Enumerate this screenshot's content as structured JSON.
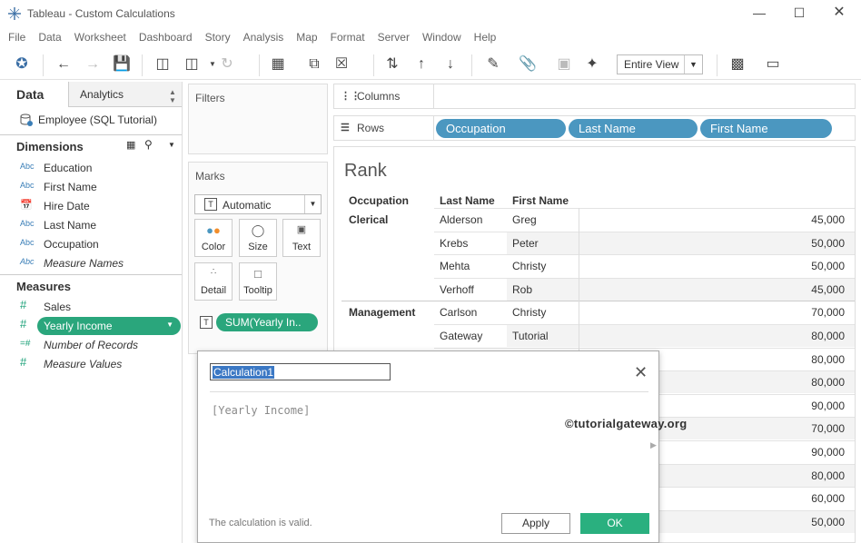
{
  "window": {
    "title": "Tableau - Custom Calculations"
  },
  "menu": [
    "File",
    "Data",
    "Worksheet",
    "Dashboard",
    "Story",
    "Analysis",
    "Map",
    "Format",
    "Server",
    "Window",
    "Help"
  ],
  "toolbar": {
    "fit_value": "Entire View"
  },
  "data_pane": {
    "tab_data": "Data",
    "tab_analytics": "Analytics",
    "datasource": "Employee (SQL Tutorial)",
    "dimensions_label": "Dimensions",
    "dimensions": [
      {
        "type": "Abc",
        "name": "Education"
      },
      {
        "type": "Abc",
        "name": "First Name"
      },
      {
        "type": "date",
        "name": "Hire Date"
      },
      {
        "type": "Abc",
        "name": "Last Name"
      },
      {
        "type": "Abc",
        "name": "Occupation"
      },
      {
        "type": "Abc",
        "name": "Measure Names"
      }
    ],
    "measures_label": "Measures",
    "measures": [
      {
        "type": "#",
        "name": "Sales"
      },
      {
        "type": "#",
        "name": "Yearly Income"
      },
      {
        "type": "=#",
        "name": "Number of Records"
      },
      {
        "type": "#",
        "name": "Measure Values"
      }
    ]
  },
  "filters": {
    "label": "Filters"
  },
  "marks": {
    "label": "Marks",
    "type": "Automatic",
    "buttons": [
      "Color",
      "Size",
      "Text",
      "Detail",
      "Tooltip"
    ],
    "pill": "SUM(Yearly In.."
  },
  "shelves": {
    "columns_label": "Columns",
    "rows_label": "Rows",
    "rows": [
      "Occupation",
      "Last Name",
      "First Name"
    ]
  },
  "view": {
    "title": "Rank",
    "headers": [
      "Occupation",
      "Last Name",
      "First Name"
    ],
    "rows": [
      {
        "occupation": "Clerical",
        "last": "Alderson",
        "first": "Greg",
        "value": "45,000"
      },
      {
        "occupation": "",
        "last": "Krebs",
        "first": "Peter",
        "value": "50,000"
      },
      {
        "occupation": "",
        "last": "Mehta",
        "first": "Christy",
        "value": "50,000"
      },
      {
        "occupation": "",
        "last": "Verhoff",
        "first": "Rob",
        "value": "45,000"
      },
      {
        "occupation": "Management",
        "last": "Carlson",
        "first": "Christy",
        "value": "70,000"
      },
      {
        "occupation": "",
        "last": "Gateway",
        "first": "Tutorial",
        "value": "80,000"
      },
      {
        "occupation": "",
        "last": "",
        "first": "",
        "value": "80,000"
      },
      {
        "occupation": "",
        "last": "",
        "first": "",
        "value": "80,000"
      },
      {
        "occupation": "",
        "last": "",
        "first": "",
        "value": "90,000"
      },
      {
        "occupation": "",
        "last": "",
        "first": "",
        "value": "70,000"
      },
      {
        "occupation": "",
        "last": "",
        "first": "",
        "value": "90,000"
      },
      {
        "occupation": "",
        "last": "",
        "first": "",
        "value": "80,000"
      },
      {
        "occupation": "",
        "last": "",
        "first": "",
        "value": "60,000"
      },
      {
        "occupation": "",
        "last": "",
        "first": "",
        "value": "50,000"
      }
    ]
  },
  "dialog": {
    "name": "Calculation1",
    "formula": "[Yearly Income]",
    "watermark": "©tutorialgateway.org",
    "status": "The calculation is valid.",
    "apply": "Apply",
    "ok": "OK"
  },
  "colors": {
    "dimension_pill": "#4b97c0",
    "measure_pill": "#2aa67c",
    "ok_button": "#2ab07f"
  }
}
